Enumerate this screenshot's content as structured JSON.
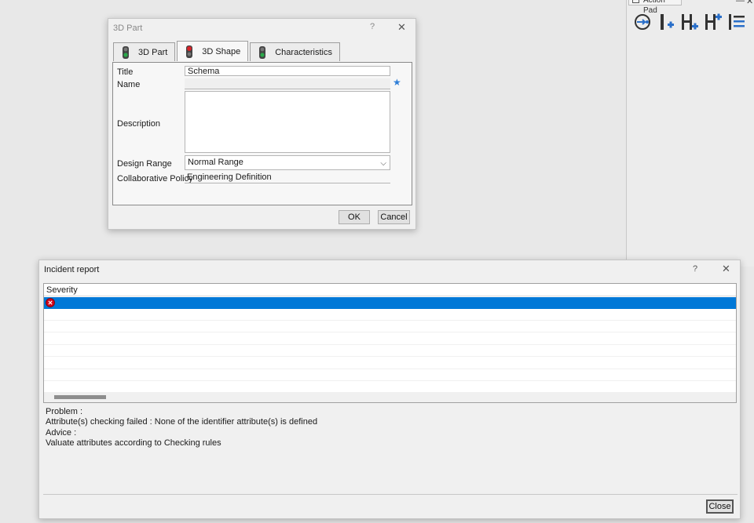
{
  "action_pad": {
    "tab_label": "Action Pad",
    "minimize_glyph": "—",
    "close_glyph": "✕",
    "tools": [
      {
        "icon": "refresh-assembly-icon"
      },
      {
        "icon": "add-part-icon"
      },
      {
        "icon": "add-product-icon"
      },
      {
        "icon": "insert-product-icon"
      },
      {
        "icon": "tree-list-icon"
      }
    ]
  },
  "part_dialog": {
    "title": "3D Part",
    "help_glyph": "?",
    "close_glyph": "✕",
    "tabs": [
      {
        "label": "3D Part",
        "icon": "green-light-icon"
      },
      {
        "label": "3D Shape",
        "icon": "red-light-icon"
      },
      {
        "label": "Characteristics",
        "icon": "green-light-icon"
      }
    ],
    "fields": {
      "title_label": "Title",
      "title_value": "Schema",
      "name_label": "Name",
      "name_value": "",
      "description_label": "Description",
      "description_value": "",
      "design_range_label": "Design Range",
      "design_range_value": "Normal Range",
      "collab_label": "Collaborative Policy",
      "collab_value": "Engineering Definition"
    },
    "ok_label": "OK",
    "cancel_label": "Cancel",
    "colors": {
      "star": "#2f7fd8",
      "red_light": "#d8232a",
      "green_light": "#2aa84a"
    }
  },
  "incident_dialog": {
    "title": "Incident report",
    "help_glyph": "?",
    "close_glyph": "✕",
    "column_header": "Severity",
    "rows": [
      {
        "severity_icon": "error-icon",
        "selected": true
      }
    ],
    "messages": [
      "Problem :",
      "Attribute(s)  checking failed : None of the identifier attribute(s) is defined",
      "Advice :",
      "Valuate attributes according to Checking rules"
    ],
    "close_label": "Close",
    "colors": {
      "selection": "#0078d7",
      "error": "#d0021b"
    }
  }
}
